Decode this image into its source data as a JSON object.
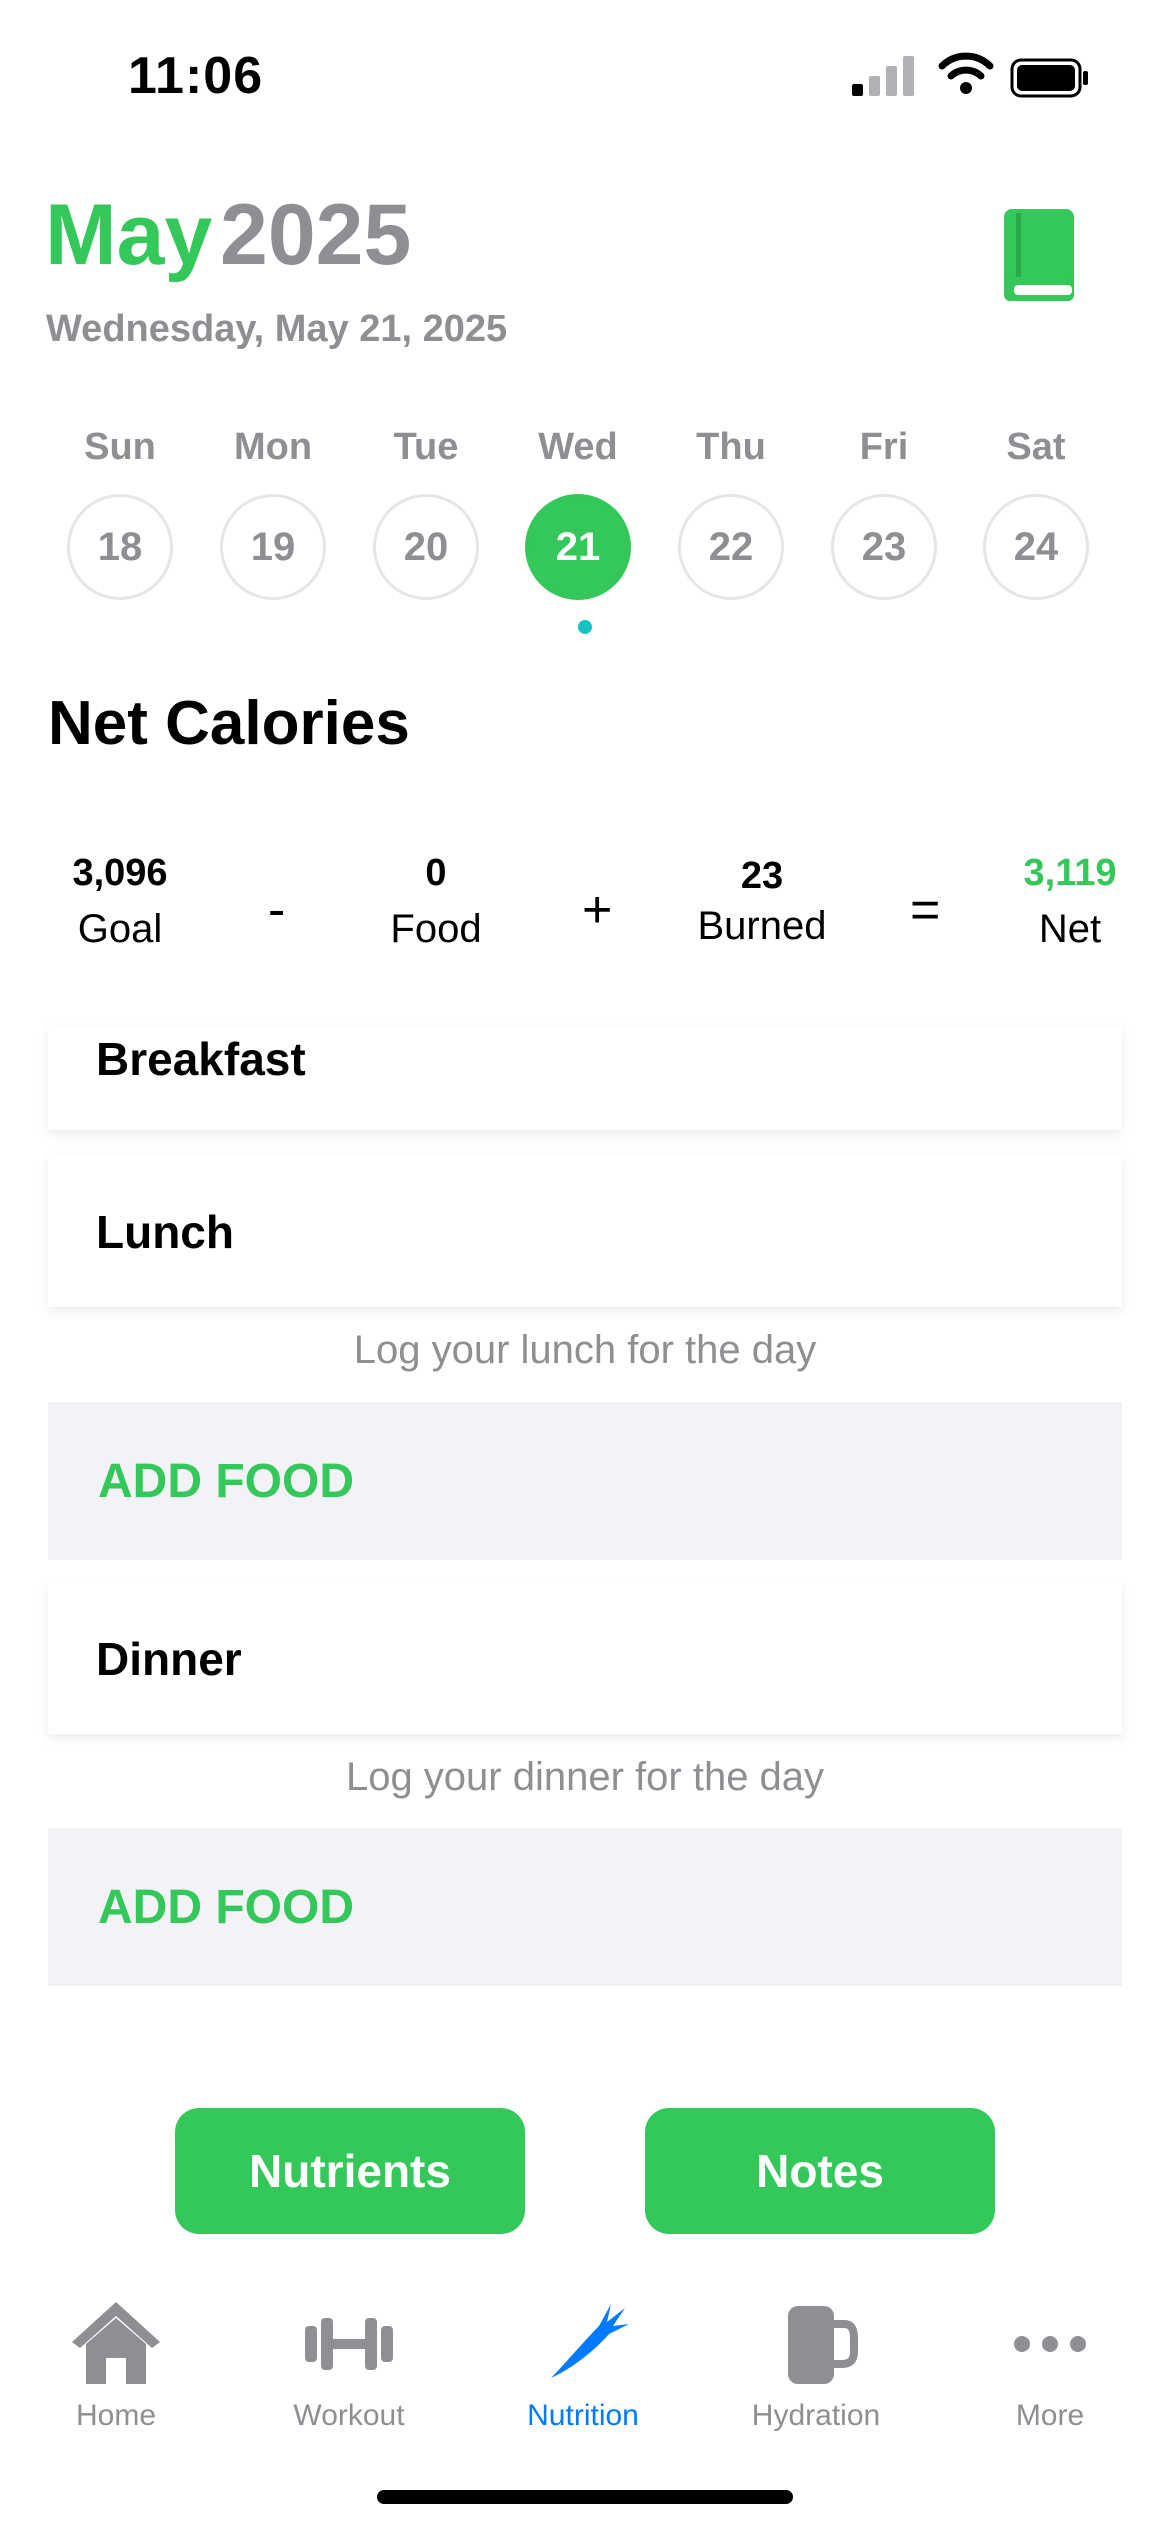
{
  "status_bar": {
    "time": "11:06"
  },
  "header": {
    "month": "May",
    "year": "2025",
    "date_line": "Wednesday, May 21, 2025",
    "icon": "book-icon"
  },
  "week": {
    "days": [
      {
        "name": "Sun",
        "num": "18"
      },
      {
        "name": "Mon",
        "num": "19"
      },
      {
        "name": "Tue",
        "num": "20"
      },
      {
        "name": "Wed",
        "num": "21"
      },
      {
        "name": "Thu",
        "num": "22"
      },
      {
        "name": "Fri",
        "num": "23"
      },
      {
        "name": "Sat",
        "num": "24"
      }
    ],
    "selected_index": 3
  },
  "net_calories": {
    "title": "Net Calories",
    "goal_value": "3,096",
    "goal_label": "Goal",
    "op1": "-",
    "food_value": "0",
    "food_label": "Food",
    "op2": "+",
    "burned_value": "23",
    "burned_label": "Burned",
    "op3": "=",
    "net_value": "3,119",
    "net_label": "Net"
  },
  "meals": {
    "breakfast": {
      "title": "Breakfast"
    },
    "lunch": {
      "title": "Lunch",
      "hint": "Log your lunch for the day",
      "add_label": "ADD FOOD"
    },
    "dinner": {
      "title": "Dinner",
      "hint": "Log your dinner for the day",
      "add_label": "ADD FOOD"
    }
  },
  "actions": {
    "nutrients": "Nutrients",
    "notes": "Notes"
  },
  "tabbar": {
    "items": [
      {
        "label": "Home",
        "icon": "home-icon"
      },
      {
        "label": "Workout",
        "icon": "dumbbell-icon"
      },
      {
        "label": "Nutrition",
        "icon": "carrot-icon"
      },
      {
        "label": "Hydration",
        "icon": "mug-icon"
      },
      {
        "label": "More",
        "icon": "more-icon"
      }
    ],
    "active_index": 2
  },
  "colors": {
    "accent": "#34c759",
    "muted": "#8e8e93",
    "active_tab": "#007aff",
    "today_dot": "#18c2c2"
  }
}
